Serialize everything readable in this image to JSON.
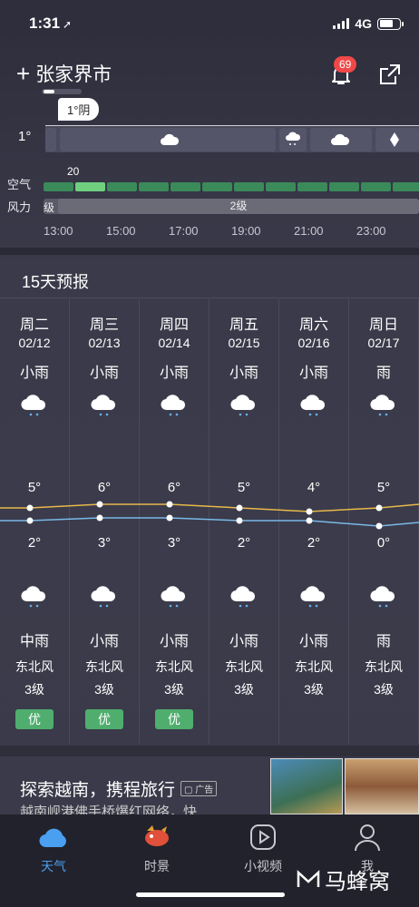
{
  "status": {
    "time": "1:31",
    "network": "4G"
  },
  "header": {
    "city": "张家界市",
    "notification_count": "69"
  },
  "hourly": {
    "tip": "1°阴",
    "temp": "1°",
    "aqi_value": "20",
    "aqi_label": "空气",
    "wind_label": "力",
    "wind_label_prefix": "风",
    "wind_pre": "级",
    "wind_main": "2级",
    "hours": [
      "13:00",
      "15:00",
      "17:00",
      "19:00",
      "21:00",
      "23:00"
    ]
  },
  "forecast": {
    "title": "15天预报",
    "days": [
      {
        "dow": "周二",
        "date": "02/12",
        "day_cond": "小雨",
        "hi": "5°",
        "lo": "2°",
        "night_cond": "中雨",
        "wind_dir": "东北风",
        "wind_lvl": "3级",
        "aq": "优"
      },
      {
        "dow": "周三",
        "date": "02/13",
        "day_cond": "小雨",
        "hi": "6°",
        "lo": "3°",
        "night_cond": "小雨",
        "wind_dir": "东北风",
        "wind_lvl": "3级",
        "aq": "优"
      },
      {
        "dow": "周四",
        "date": "02/14",
        "day_cond": "小雨",
        "hi": "6°",
        "lo": "3°",
        "night_cond": "小雨",
        "wind_dir": "东北风",
        "wind_lvl": "3级",
        "aq": "优"
      },
      {
        "dow": "周五",
        "date": "02/15",
        "day_cond": "小雨",
        "hi": "5°",
        "lo": "2°",
        "night_cond": "小雨",
        "wind_dir": "东北风",
        "wind_lvl": "3级",
        "aq": ""
      },
      {
        "dow": "周六",
        "date": "02/16",
        "day_cond": "小雨",
        "hi": "4°",
        "lo": "2°",
        "night_cond": "小雨",
        "wind_dir": "东北风",
        "wind_lvl": "3级",
        "aq": ""
      },
      {
        "dow": "周日",
        "date": "02/17",
        "day_cond": "雨",
        "hi": "5°",
        "lo": "0°",
        "night_cond": "雨",
        "wind_dir": "东北风",
        "wind_lvl": "3级",
        "aq": ""
      }
    ],
    "hi_values": [
      5,
      6,
      6,
      5,
      4,
      5
    ],
    "lo_values": [
      2,
      3,
      3,
      2,
      2,
      0
    ]
  },
  "ad": {
    "title": "探索越南，携程旅行",
    "tag": "广告",
    "subtitle": "越南岘港佛手桥爆红网络，快"
  },
  "tabs": [
    {
      "label": "天气",
      "icon": "cloud-icon",
      "active": true
    },
    {
      "label": "时景",
      "icon": "fish-icon",
      "active": false
    },
    {
      "label": "小视频",
      "icon": "play-icon",
      "active": false
    },
    {
      "label": "我",
      "icon": "user-icon",
      "active": false
    }
  ],
  "watermark": "马蜂窝",
  "colors": {
    "accent": "#4a9ff0",
    "good_aq": "#4fae6e",
    "hi_line": "#e8b84a",
    "lo_line": "#7ab8e8",
    "badge": "#f04848"
  }
}
